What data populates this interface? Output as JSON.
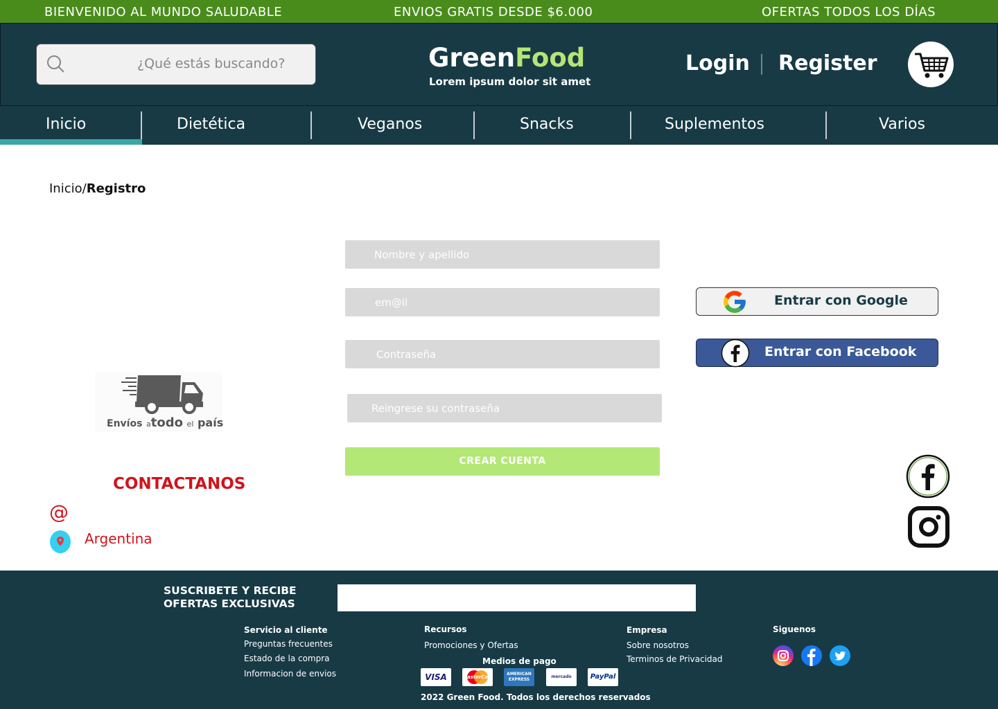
{
  "topbar": {
    "left": "BIENVENIDO AL MUNDO SALUDABLE",
    "center": "ENVIOS GRATIS DESDE $6.000",
    "right": "OFERTAS TODOS LOS DÍAS"
  },
  "header": {
    "search_placeholder": "¿Qué estás buscando?",
    "logo_green": "Green",
    "logo_food": "Food",
    "tagline": "Lorem ipsum dolor sit amet",
    "login": "Login",
    "register": "Register"
  },
  "nav": {
    "items": [
      "Inicio",
      "Dietética",
      "Veganos",
      "Snacks",
      "Suplementos",
      "Varios"
    ],
    "active": "Inicio"
  },
  "breadcrumb": {
    "home": "Inicio/",
    "current": "Registro"
  },
  "form": {
    "name_placeholder": "Nombre y apellido",
    "email_placeholder": "em@il",
    "password_placeholder": "Contraseña",
    "password_repeat_placeholder": "Reingrese su contraseña",
    "submit": "CREAR CUENTA"
  },
  "social_login": {
    "google": "Entrar con Google",
    "facebook": "Entrar con Facebook"
  },
  "shipping_badge": {
    "text_1": "Envíos",
    "text_2": "a",
    "text_3": "todo",
    "text_4": "el",
    "text_5": "país"
  },
  "contact": {
    "title": "CONTACTANOS",
    "email_symbol": "@",
    "country": "Argentina"
  },
  "footer": {
    "subscribe_line1": "SUSCRIBETE Y RECIBE",
    "subscribe_line2": "OFERTAS EXCLUSIVAS",
    "customer_service": {
      "title": "Servicio al cliente",
      "links": [
        "Preguntas frecuentes",
        "Estado de la compra",
        "Informacion de envios"
      ]
    },
    "resources": {
      "title": "Recursos",
      "links": [
        "Promociones y Ofertas"
      ]
    },
    "company": {
      "title": "Empresa",
      "links": [
        "Sobre nosotros",
        "Terminos de Privacidad"
      ]
    },
    "follow": {
      "title": "Siguenos"
    },
    "payment": {
      "title": "Medios de pago",
      "methods": [
        "VISA",
        "MasterCard",
        "AMERICAN EXPRESS",
        "mercado pago",
        "PayPal"
      ]
    },
    "copyright": "2022 Green Food. Todos los derechos reservados"
  },
  "colors": {
    "topbar": "#4a8c1c",
    "header_bg": "#173a45",
    "accent_green": "#b5e576",
    "nav_active": "#3aa6a6",
    "contact_red": "#d0141c",
    "facebook_blue": "#3b5998"
  }
}
